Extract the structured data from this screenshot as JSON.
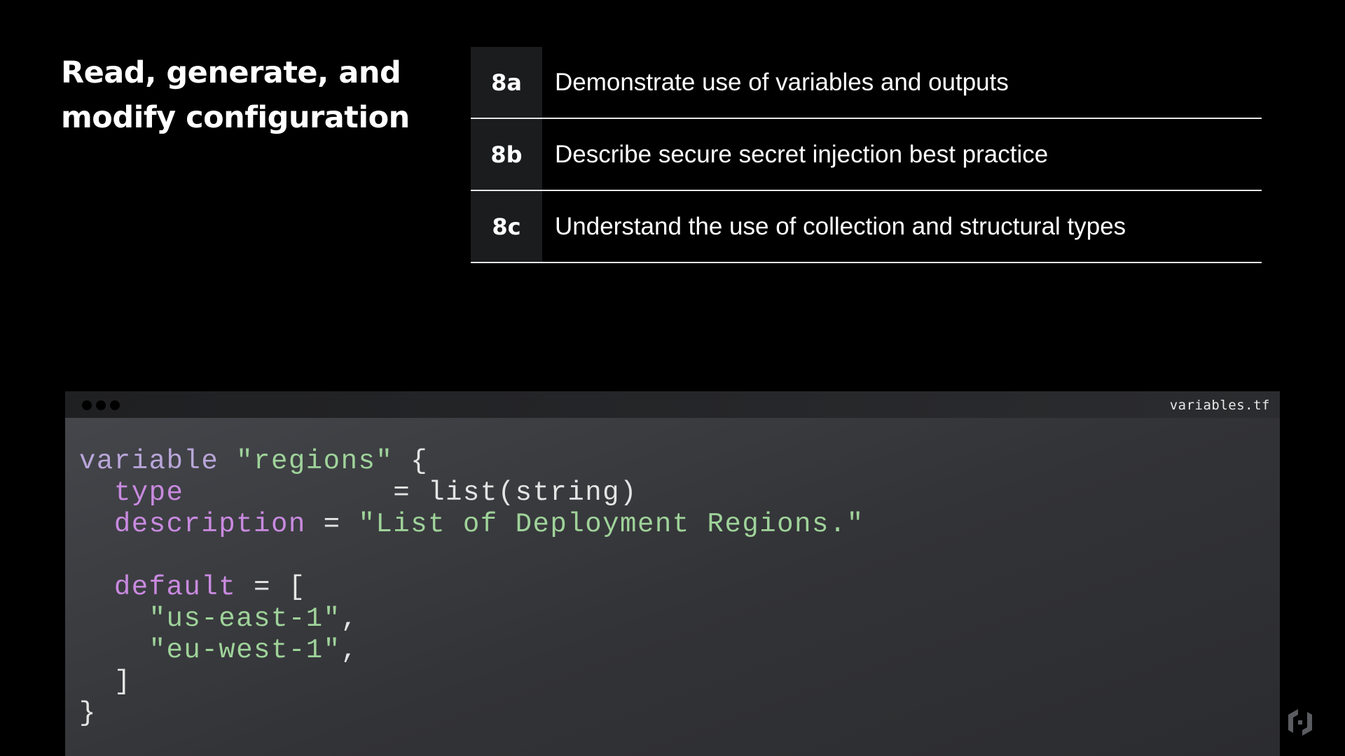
{
  "slide": {
    "title_line1": "Read, generate, and",
    "title_line2": "modify configuration"
  },
  "objectives": [
    {
      "code": "8a",
      "text": "Demonstrate use of variables and outputs"
    },
    {
      "code": "8b",
      "text": "Describe secure secret injection best practice"
    },
    {
      "code": "8c",
      "text": "Understand the use of collection and structural types"
    }
  ],
  "editor": {
    "filename": "variables.tf",
    "code": {
      "l1_keyword": "variable",
      "l1_name": "\"regions\"",
      "l1_brace": "{",
      "l2_attr": "type",
      "l2_eq": "=",
      "l2_value": "list(string)",
      "l3_attr": "description",
      "l3_eq": "=",
      "l3_value": "\"List of Deployment Regions.\"",
      "l5_attr": "default",
      "l5_eq": "=",
      "l5_open": "[",
      "l6_value": "\"us-east-1\"",
      "l6_comma": ",",
      "l7_value": "\"eu-west-1\"",
      "l7_comma": ",",
      "l8_close": "]",
      "l9_close": "}"
    }
  },
  "colors": {
    "background": "#000000",
    "code_keyword": "#b9a6d9",
    "code_attribute": "#c98ae0",
    "code_string": "#9fd39a",
    "code_plain": "#e4e4e4"
  },
  "logo_icon": "hashicorp-logo-icon"
}
